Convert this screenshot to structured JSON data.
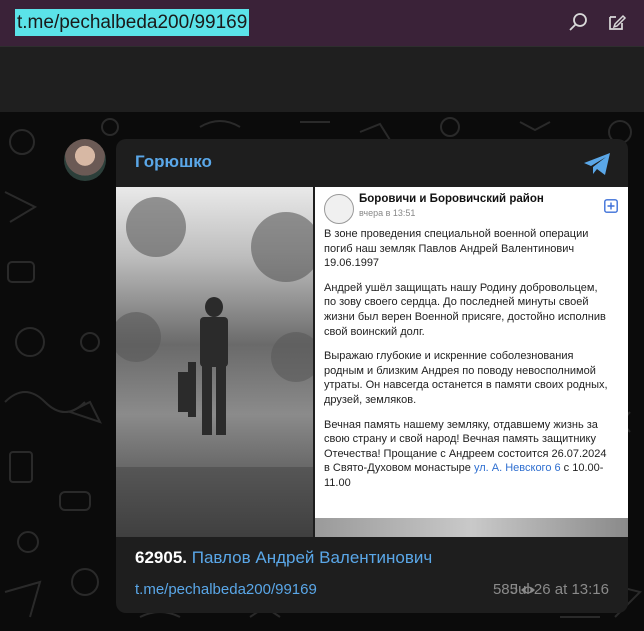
{
  "browser": {
    "url": "t.me/pechalbeda200/99169",
    "search_icon": "search-icon",
    "edit_icon": "edit-icon"
  },
  "post": {
    "channel_name": "Горюшко",
    "source_card": {
      "title": "Боровичи и Боровичский район",
      "time": "вчера в 13:51",
      "paragraphs": [
        "В зоне проведения специальной военной операции погиб наш земляк Павлов Андрей Валентинович 19.06.1997",
        "Андрей ушёл защищать нашу Родину добровольцем, по зову своего сердца. До последней минуты своей жизни был верен Военной присяге, достойно исполнив свой воинский долг.",
        "Выражаю глубокие и искренние соболезнования родным и близким Андрея по поводу невосполнимой утраты. Он навсегда останется в памяти своих родных, друзей, земляков.",
        "Вечная память нашему земляку, отдавшему жизнь за свою страну и свой народ! Вечная память защитнику Отечества! Прощание с Андреем состоится 26.07.2024 в Свято-Духовом монастыре"
      ],
      "address_link": "ул. А. Невского 6",
      "address_tail": " с 10.00-11.00"
    },
    "number": "62905.",
    "name_link": "Павлов Андрей Валентинович",
    "message_link": "t.me/pechalbeda200/99169",
    "views": "585",
    "date": "Jul 26 at 13:16"
  },
  "colors": {
    "accent": "#5aa7e8",
    "url_highlight": "#5be3e9",
    "topbar": "#3a2238"
  }
}
